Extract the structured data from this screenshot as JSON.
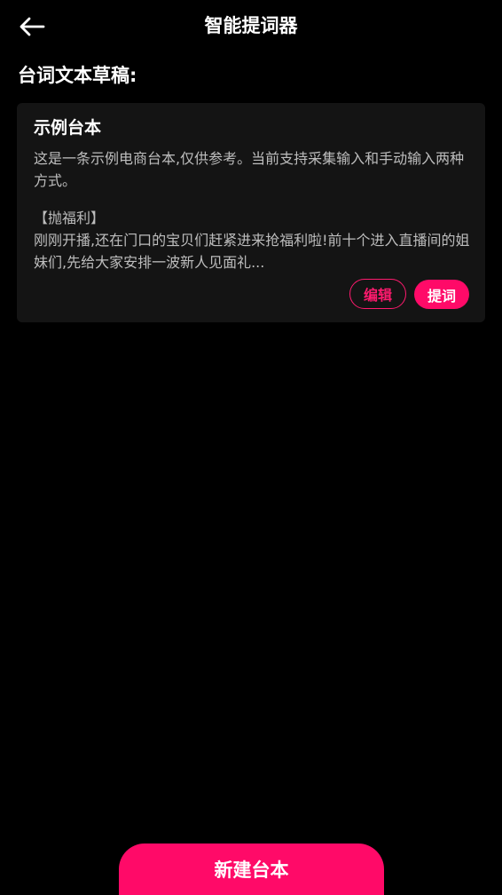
{
  "header": {
    "title": "智能提词器",
    "back_icon": "arrow-left-icon"
  },
  "section": {
    "title": "台词文本草稿:"
  },
  "scripts": [
    {
      "title": "示例台本",
      "description": "这是一条示例电商台本,仅供参考。当前支持采集输入和手动输入两种方式。",
      "tag": "【抛福利】",
      "body": "刚刚开播,还在门口的宝贝们赶紧进来抢福利啦!前十个进入直播间的姐妹们,先给大家安排一波新人见面礼...",
      "edit_label": "编辑",
      "prompt_label": "提词"
    }
  ],
  "footer": {
    "new_label": "新建台本"
  },
  "colors": {
    "accent": "#ff0a68",
    "background": "#000000",
    "card": "#141414",
    "text_secondary": "#bdbdbd"
  }
}
